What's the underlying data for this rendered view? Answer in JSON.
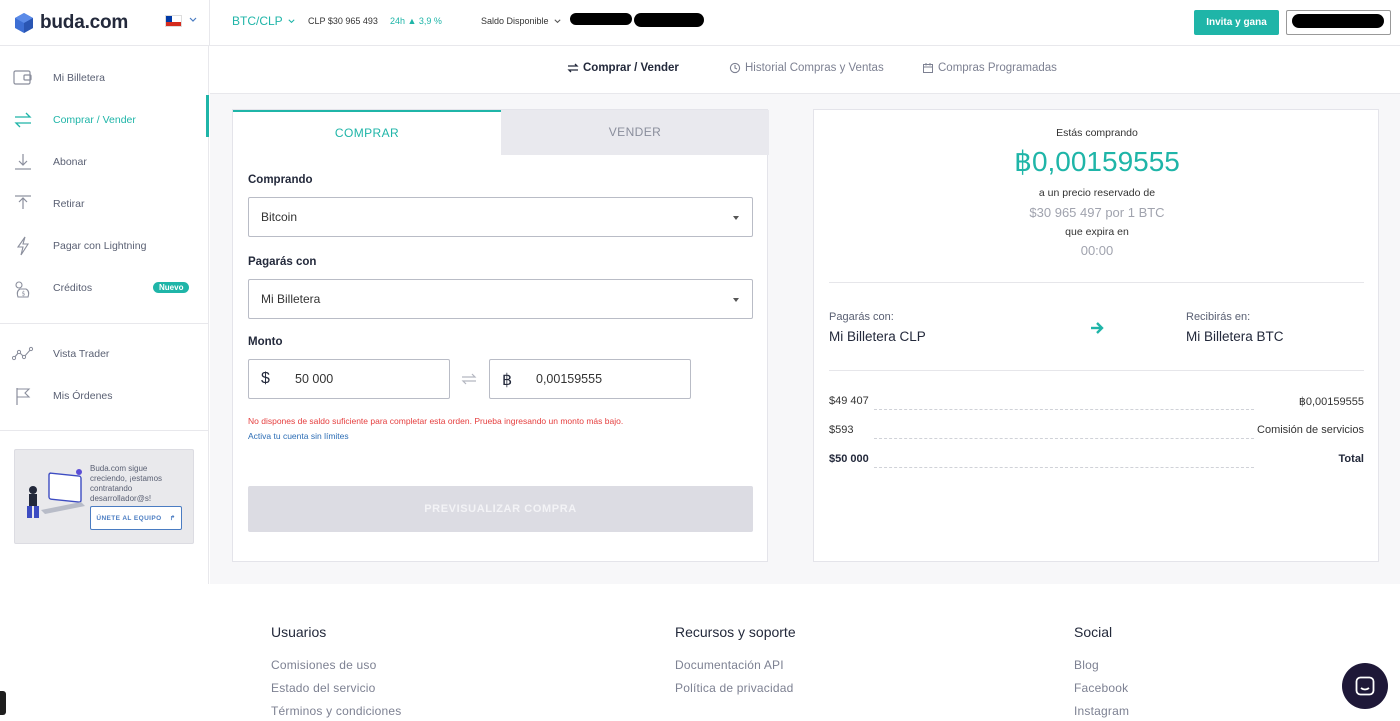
{
  "brand": {
    "name": "buda.com"
  },
  "topbar": {
    "pair": "BTC/CLP",
    "price": "CLP $30 965 493",
    "change": "24h ▲ 3,9 %",
    "balance_label": "Saldo Disponible",
    "invite_label": "Invita y gana"
  },
  "sidebar": {
    "items": [
      {
        "label": "Mi Billetera",
        "icon": "wallet-icon"
      },
      {
        "label": "Comprar / Vender",
        "icon": "transfer-arrows-icon"
      },
      {
        "label": "Abonar",
        "icon": "download-icon"
      },
      {
        "label": "Retirar",
        "icon": "upload-icon"
      },
      {
        "label": "Pagar con Lightning",
        "icon": "lightning-icon"
      },
      {
        "label": "Créditos",
        "icon": "coin-bag-icon",
        "badge": "Nuevo"
      },
      {
        "label": "Vista Trader",
        "icon": "chart-line-icon"
      },
      {
        "label": "Mis Órdenes",
        "icon": "flag-icon"
      }
    ],
    "promo": {
      "text": "Buda.com sigue creciendo, ¡estamos contratando desarrollador@s!",
      "button": "ÚNETE AL EQUIPO"
    }
  },
  "subnav": {
    "tabs": [
      {
        "label": "Comprar / Vender",
        "active": true
      },
      {
        "label": "Historial Compras y Ventas"
      },
      {
        "label": "Compras Programadas"
      }
    ]
  },
  "buy": {
    "tabs": {
      "buy": "COMPRAR",
      "sell": "VENDER"
    },
    "buying_label": "Comprando",
    "buying_value": "Bitcoin",
    "pay_label": "Pagarás con",
    "pay_value": "Mi Billetera",
    "amount_label": "Monto",
    "amount_fiat_symbol": "$",
    "amount_fiat": "50 000",
    "amount_crypto_symbol": "฿",
    "amount_crypto": "0,00159555",
    "error": "No dispones de saldo suficiente para completar esta orden. Prueba ingresando un monto más bajo.",
    "activate_link": "Activa tu cuenta sin límites",
    "preview_button": "PREVISUALIZAR COMPRA"
  },
  "summary": {
    "buying_title": "Estás comprando",
    "amount": "฿0,00159555",
    "reserved_label": "a un precio reservado de",
    "reserved_price": "$30 965 497 por 1 BTC",
    "expires_label": "que expira en",
    "expires_value": "00:00",
    "pay_with_label": "Pagarás con:",
    "pay_with_value": "Mi Billetera CLP",
    "receive_label": "Recibirás en:",
    "receive_value": "Mi Billetera BTC",
    "rows": [
      {
        "left": "$49 407",
        "right": "฿0,00159555"
      },
      {
        "left": "$593",
        "right": "Comisión de servicios"
      },
      {
        "left": "$50 000",
        "right": "Total"
      }
    ]
  },
  "footer": {
    "columns": [
      {
        "title": "Usuarios",
        "links": [
          "Comisiones de uso",
          "Estado del servicio",
          "Términos y condiciones"
        ]
      },
      {
        "title": "Recursos y soporte",
        "links": [
          "Documentación API",
          "Política de privacidad"
        ]
      },
      {
        "title": "Social",
        "links": [
          "Blog",
          "Facebook",
          "Instagram"
        ]
      }
    ]
  },
  "colors": {
    "accent": "#1fb5a8",
    "error": "#e53e3e",
    "dark": "#23293b"
  }
}
